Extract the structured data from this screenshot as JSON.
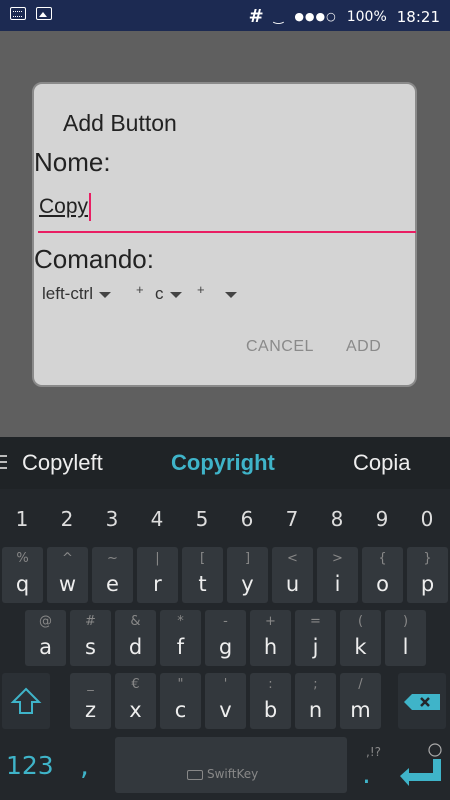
{
  "status_bar": {
    "hash": "#",
    "signal": "‿",
    "dots": "●●●○",
    "battery": "100%",
    "time": "18:21",
    "left_icons": [
      "keyboard-icon",
      "image-icon"
    ]
  },
  "dialog": {
    "title": "Add Button",
    "name_label": "Nome:",
    "name_value": "Copy",
    "command_label": "Comando:",
    "command_items": [
      "left-ctrl",
      "c",
      ""
    ],
    "plus": "+",
    "cancel_label": "CANCEL",
    "add_label": "ADD"
  },
  "keyboard": {
    "suggestions": [
      "Copyleft",
      "Copyright",
      "Copia"
    ],
    "numbers": [
      "1",
      "2",
      "3",
      "4",
      "5",
      "6",
      "7",
      "8",
      "9",
      "0"
    ],
    "row1": [
      {
        "main": "q",
        "alt": "%"
      },
      {
        "main": "w",
        "alt": "^"
      },
      {
        "main": "e",
        "alt": "~"
      },
      {
        "main": "r",
        "alt": "|"
      },
      {
        "main": "t",
        "alt": "["
      },
      {
        "main": "y",
        "alt": "]"
      },
      {
        "main": "u",
        "alt": "<"
      },
      {
        "main": "i",
        "alt": ">"
      },
      {
        "main": "o",
        "alt": "{"
      },
      {
        "main": "p",
        "alt": "}"
      }
    ],
    "row2": [
      {
        "main": "a",
        "alt": "@"
      },
      {
        "main": "s",
        "alt": "#"
      },
      {
        "main": "d",
        "alt": "&"
      },
      {
        "main": "f",
        "alt": "*"
      },
      {
        "main": "g",
        "alt": "-"
      },
      {
        "main": "h",
        "alt": "+"
      },
      {
        "main": "j",
        "alt": "="
      },
      {
        "main": "k",
        "alt": "("
      },
      {
        "main": "l",
        "alt": ")"
      }
    ],
    "row3": [
      {
        "main": "z",
        "alt": "_"
      },
      {
        "main": "x",
        "alt": "€"
      },
      {
        "main": "c",
        "alt": "\""
      },
      {
        "main": "v",
        "alt": "'"
      },
      {
        "main": "b",
        "alt": ":"
      },
      {
        "main": "n",
        "alt": ";"
      },
      {
        "main": "m",
        "alt": "/"
      }
    ],
    "key_123": "123",
    "comma": ",",
    "brand": "SwiftKey",
    "period": ".",
    "period_alt": ",!?",
    "accent_color": "#3fb4c9"
  }
}
